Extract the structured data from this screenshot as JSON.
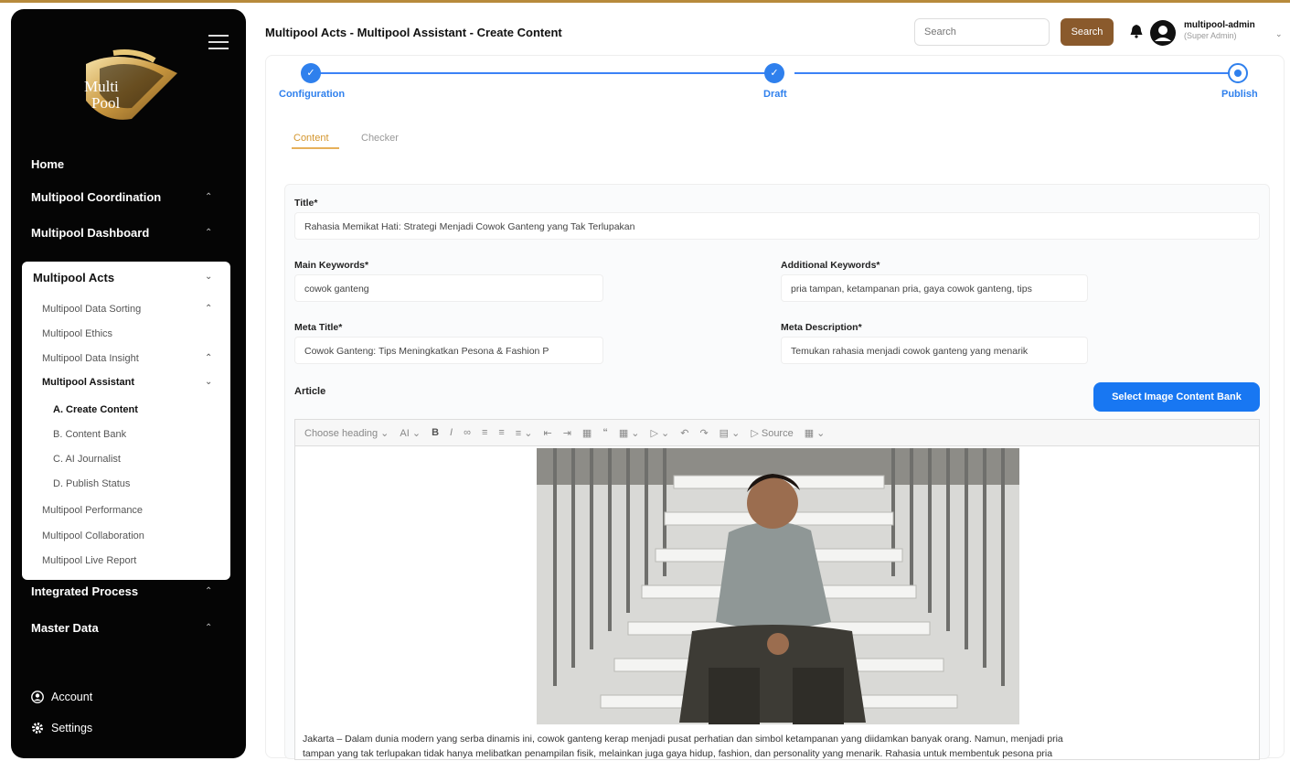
{
  "sidebar": {
    "logo_text": "Multi Pool",
    "nav": [
      {
        "label": "Home"
      },
      {
        "label": "Multipool Coordination"
      },
      {
        "label": "Multipool Dashboard"
      },
      {
        "label": "Integrated Process"
      },
      {
        "label": "Master Data"
      }
    ],
    "active_section": {
      "label": "Multipool Acts",
      "items": [
        {
          "label": "Multipool Data Sorting"
        },
        {
          "label": "Multipool Ethics"
        },
        {
          "label": "Multipool Data Insight"
        },
        {
          "label": "Multipool Assistant"
        },
        {
          "label": "A. Create Content"
        },
        {
          "label": "B. Content Bank"
        },
        {
          "label": "C. AI Journalist"
        },
        {
          "label": "D. Publish Status"
        },
        {
          "label": "Multipool Performance"
        },
        {
          "label": "Multipool Collaboration"
        },
        {
          "label": "Multipool Live Report"
        }
      ]
    },
    "account_label": "Account",
    "settings_label": "Settings"
  },
  "header": {
    "title": "Multipool Acts - Multipool Assistant - Create Content",
    "search_placeholder": "Search",
    "search_button": "Search",
    "user_name": "multipool-admin",
    "user_role": "(Super Admin)"
  },
  "stepper": {
    "steps": [
      {
        "label": "Configuration",
        "state": "done"
      },
      {
        "label": "Draft",
        "state": "done"
      },
      {
        "label": "Publish",
        "state": "current"
      }
    ]
  },
  "tabs": [
    {
      "label": "Content",
      "active": true
    },
    {
      "label": "Checker",
      "active": false
    }
  ],
  "form": {
    "title_label": "Title*",
    "title_value": "Rahasia Memikat Hati: Strategi Menjadi Cowok Ganteng yang Tak Terlupakan",
    "main_keywords_label": "Main Keywords*",
    "main_keywords_value": "cowok ganteng",
    "additional_keywords_label": "Additional Keywords*",
    "additional_keywords_value": "pria tampan, ketampanan pria, gaya cowok ganteng, tips",
    "meta_title_label": "Meta Title*",
    "meta_title_value": "Cowok Ganteng: Tips Meningkatkan Pesona & Fashion P",
    "meta_description_label": "Meta Description*",
    "meta_description_value": "Temukan rahasia menjadi cowok ganteng yang menarik",
    "article_label": "Article",
    "image_bank_button": "Select Image Content Bank"
  },
  "editor": {
    "heading_select": "Choose heading",
    "source_label": "Source",
    "article_text_1": "Jakarta – Dalam dunia modern yang serba dinamis ini, cowok ganteng kerap menjadi pusat perhatian dan simbol ketampanan yang diidamkan banyak orang. Namun, menjadi pria",
    "article_text_2": "tampan yang tak terlupakan tidak hanya melibatkan penampilan fisik, melainkan juga gaya hidup, fashion, dan personality yang menarik. Rahasia untuk membentuk pesona pria"
  }
}
